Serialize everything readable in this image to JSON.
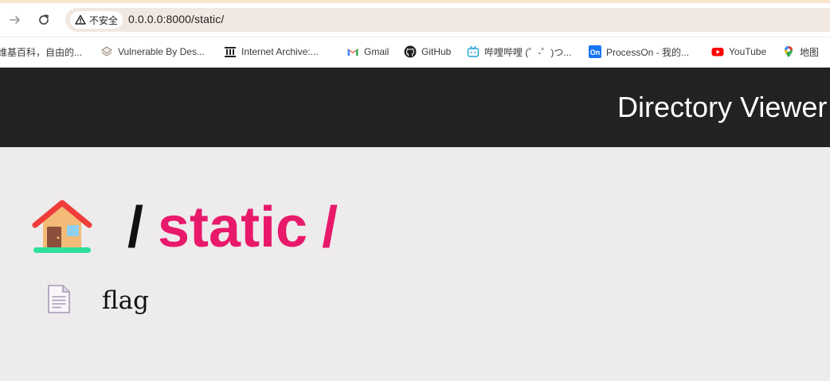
{
  "browser": {
    "security_label": "不安全",
    "url": "0.0.0.0:8000/static/",
    "bookmarks": [
      {
        "label": "维基百科，自由的...",
        "icon": "wikipedia-icon"
      },
      {
        "label": "Vulnerable By Des...",
        "icon": "vulnhub-icon"
      },
      {
        "label": "Internet Archive:...",
        "icon": "archive-icon"
      },
      {
        "label": "Gmail",
        "icon": "gmail-icon"
      },
      {
        "label": "GitHub",
        "icon": "github-icon"
      },
      {
        "label": "哔哩哔哩 (゜-゜)つ...",
        "icon": "bilibili-icon"
      },
      {
        "label": "ProcessOn - 我的...",
        "icon": "processon-icon"
      },
      {
        "label": "YouTube",
        "icon": "youtube-icon"
      },
      {
        "label": "地图",
        "icon": "maps-icon"
      }
    ]
  },
  "header": {
    "title": "Directory Viewer"
  },
  "breadcrumb": {
    "separator": "/",
    "folder": "static",
    "trailing_separator": "/",
    "home_icon": "house-icon"
  },
  "files": [
    {
      "name": "flag",
      "icon": "document-icon"
    }
  ],
  "colors": {
    "header_bg": "#232122",
    "accent": "#e8196a",
    "page_bg": "#edebec"
  }
}
